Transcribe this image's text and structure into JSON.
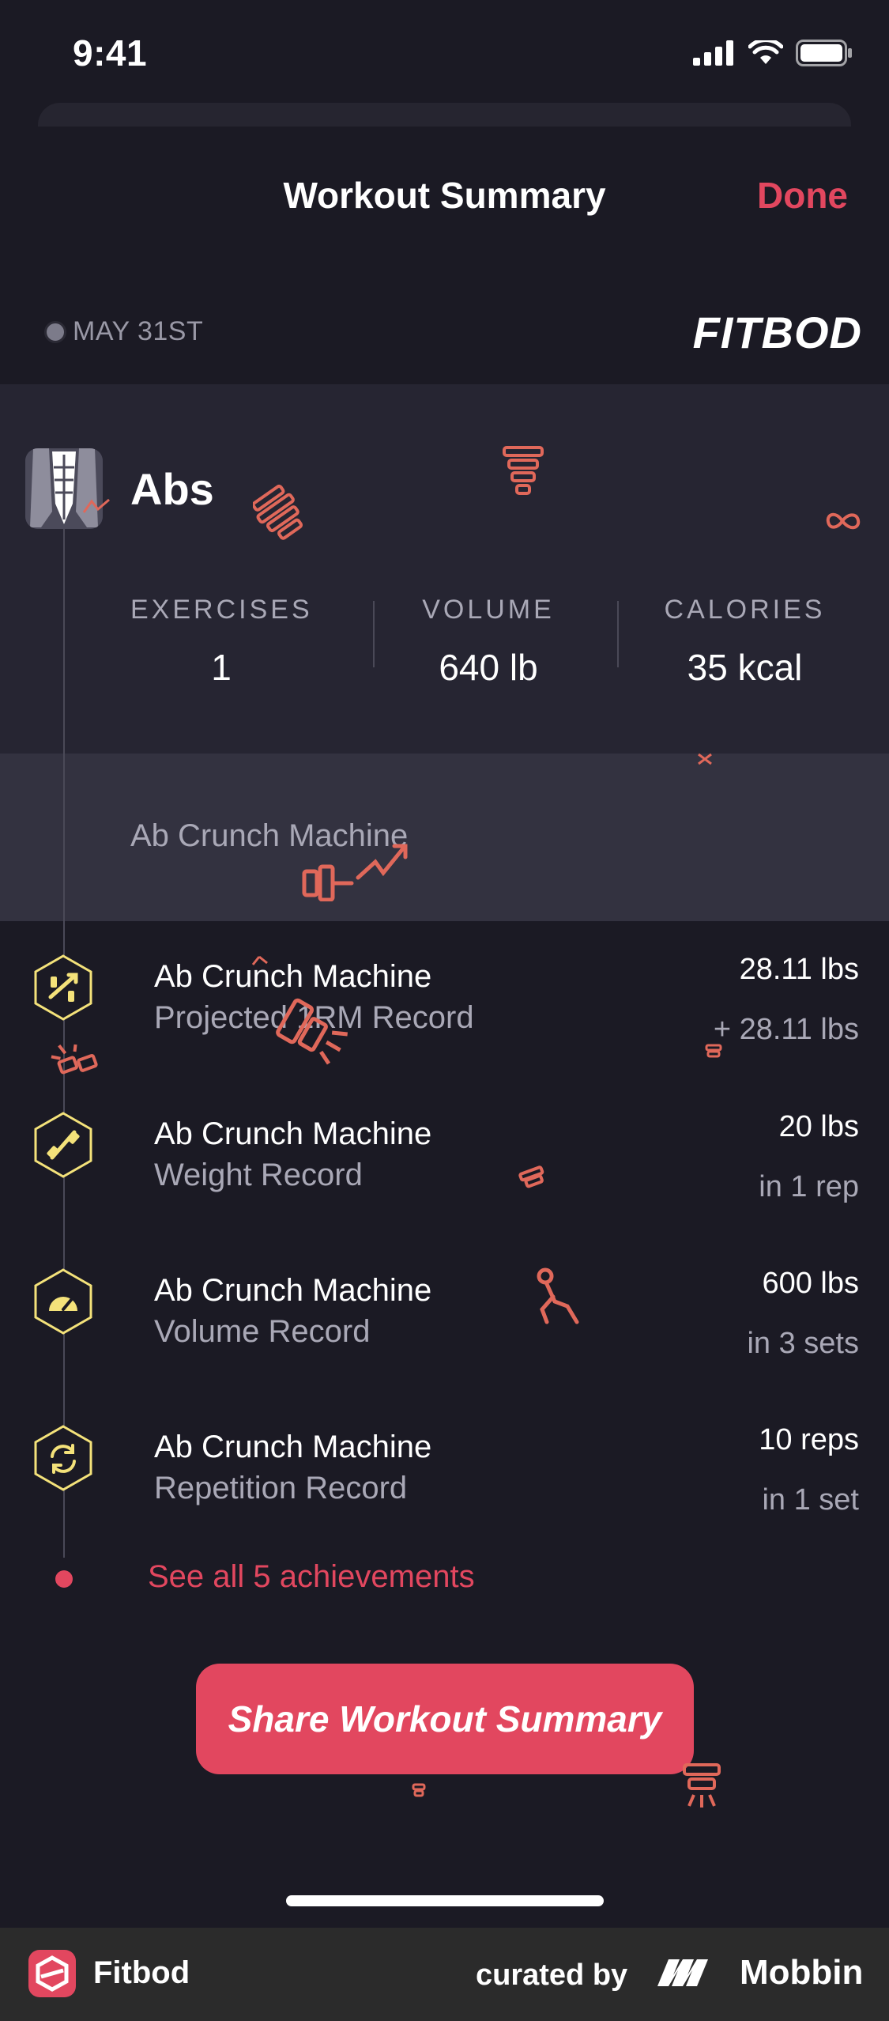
{
  "status_bar": {
    "time": "9:41",
    "signal_icon": "cellular-signal-icon",
    "wifi_icon": "wifi-icon",
    "battery_icon": "battery-icon"
  },
  "header": {
    "title": "Workout Summary",
    "done_label": "Done"
  },
  "date_row": {
    "date": "MAY 31ST",
    "brand": "FITBOD"
  },
  "muscle_group": {
    "name": "Abs",
    "icon": "abs-muscle-icon",
    "stats": [
      {
        "label": "EXERCISES",
        "value": "1"
      },
      {
        "label": "VOLUME",
        "value": "640 lb"
      },
      {
        "label": "CALORIES",
        "value": "35 kcal"
      }
    ]
  },
  "exercises": [
    {
      "name": "Ab Crunch Machine"
    }
  ],
  "achievements": [
    {
      "icon": "projected-1rm-icon",
      "title": "Ab Crunch Machine",
      "subtitle": "Projected 1RM Record",
      "value": "28.11 lbs",
      "detail": "+ 28.11 lbs"
    },
    {
      "icon": "weight-record-icon",
      "title": "Ab Crunch Machine",
      "subtitle": "Weight Record",
      "value": "20 lbs",
      "detail": "in 1 rep"
    },
    {
      "icon": "volume-record-icon",
      "title": "Ab Crunch Machine",
      "subtitle": "Volume Record",
      "value": "600 lbs",
      "detail": "in 3 sets"
    },
    {
      "icon": "repetition-record-icon",
      "title": "Ab Crunch Machine",
      "subtitle": "Repetition Record",
      "value": "10 reps",
      "detail": "in 1 set"
    }
  ],
  "see_all": "See all 5 achievements",
  "share_button": "Share Workout Summary",
  "footer": {
    "app_name": "Fitbod",
    "curated_by": "curated by",
    "brand": "Mobbin"
  },
  "colors": {
    "accent": "#e2475f",
    "background": "#1b1a24",
    "panel": "#262532",
    "row": "#333240",
    "badge": "#f4e27a"
  }
}
